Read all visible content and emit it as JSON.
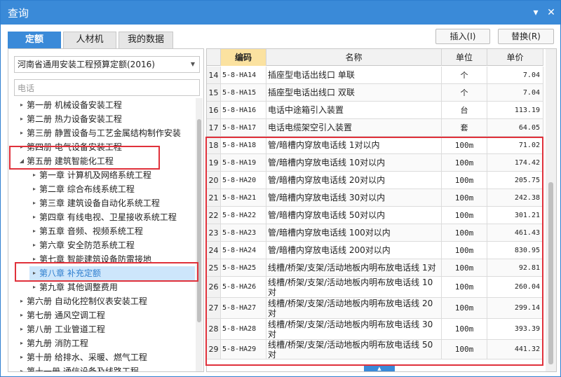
{
  "window": {
    "title": "查询",
    "menu_icon": "▾",
    "close_icon": "✕"
  },
  "tabs": [
    {
      "label": "定额"
    },
    {
      "label": "人材机"
    },
    {
      "label": "我的数据"
    }
  ],
  "actions": {
    "insert": "插入(I)",
    "replace": "替换(R)"
  },
  "library": {
    "selected": "河南省通用安装工程预算定额(2016)"
  },
  "search": {
    "value": "电话"
  },
  "tree": [
    {
      "label": "第一册  机械设备安装工程",
      "toggle": "▸"
    },
    {
      "label": "第二册  热力设备安装工程",
      "toggle": "▸"
    },
    {
      "label": "第三册  静置设备与工艺金属结构制作安装",
      "toggle": "▸"
    },
    {
      "label": "第四册  电气设备安装工程",
      "toggle": "▸"
    },
    {
      "label": "第五册  建筑智能化工程",
      "toggle": "◢"
    },
    {
      "label": "第一章  计算机及网络系统工程",
      "toggle": "▸"
    },
    {
      "label": "第二章  综合布线系统工程",
      "toggle": "▸"
    },
    {
      "label": "第三章  建筑设备自动化系统工程",
      "toggle": "▸"
    },
    {
      "label": "第四章  有线电视、卫星接收系统工程",
      "toggle": "▸"
    },
    {
      "label": "第五章  音频、视频系统工程",
      "toggle": "▸"
    },
    {
      "label": "第六章  安全防范系统工程",
      "toggle": "▸"
    },
    {
      "label": "第七章  智能建筑设备防雷接地",
      "toggle": "▸"
    },
    {
      "label": "第八章  补充定额",
      "toggle": "▸"
    },
    {
      "label": "第九章  其他调整费用",
      "toggle": "▸"
    },
    {
      "label": "第六册  自动化控制仪表安装工程",
      "toggle": "▸"
    },
    {
      "label": "第七册  通风空调工程",
      "toggle": "▸"
    },
    {
      "label": "第八册  工业管道工程",
      "toggle": "▸"
    },
    {
      "label": "第九册  消防工程",
      "toggle": "▸"
    },
    {
      "label": "第十册  给排水、采暖、燃气工程",
      "toggle": "▸"
    },
    {
      "label": "第十一册  通信设备及线路工程",
      "toggle": "▸"
    }
  ],
  "table": {
    "headers": {
      "no": "",
      "code": "编码",
      "name": "名称",
      "unit": "单位",
      "price": "单价"
    },
    "rows": [
      {
        "no": "14",
        "code": "5-8-HA14",
        "name": "插座型电话出线口 单联",
        "unit": "个",
        "price": "7.04"
      },
      {
        "no": "15",
        "code": "5-8-HA15",
        "name": "插座型电话出线口 双联",
        "unit": "个",
        "price": "7.04"
      },
      {
        "no": "16",
        "code": "5-8-HA16",
        "name": "电话中途箱引入装置",
        "unit": "台",
        "price": "113.19"
      },
      {
        "no": "17",
        "code": "5-8-HA17",
        "name": "电话电缆架空引入装置",
        "unit": "套",
        "price": "64.05"
      },
      {
        "no": "18",
        "code": "5-8-HA18",
        "name": "管/暗槽内穿放电话线 1对以内",
        "unit": "100m",
        "price": "71.02"
      },
      {
        "no": "19",
        "code": "5-8-HA19",
        "name": "管/暗槽内穿放电话线 10对以内",
        "unit": "100m",
        "price": "174.42"
      },
      {
        "no": "20",
        "code": "5-8-HA20",
        "name": "管/暗槽内穿放电话线 20对以内",
        "unit": "100m",
        "price": "205.75"
      },
      {
        "no": "21",
        "code": "5-8-HA21",
        "name": "管/暗槽内穿放电话线 30对以内",
        "unit": "100m",
        "price": "242.38"
      },
      {
        "no": "22",
        "code": "5-8-HA22",
        "name": "管/暗槽内穿放电话线 50对以内",
        "unit": "100m",
        "price": "301.21"
      },
      {
        "no": "23",
        "code": "5-8-HA23",
        "name": "管/暗槽内穿放电话线 100对以内",
        "unit": "100m",
        "price": "461.43"
      },
      {
        "no": "24",
        "code": "5-8-HA24",
        "name": "管/暗槽内穿放电话线 200对以内",
        "unit": "100m",
        "price": "830.95"
      },
      {
        "no": "25",
        "code": "5-8-HA25",
        "name": "线槽/桥架/支架/活动地板内明布放电话线 1对",
        "unit": "100m",
        "price": "92.81"
      },
      {
        "no": "26",
        "code": "5-8-HA26",
        "name": "线槽/桥架/支架/活动地板内明布放电话线 10对",
        "unit": "100m",
        "price": "260.04"
      },
      {
        "no": "27",
        "code": "5-8-HA27",
        "name": "线槽/桥架/支架/活动地板内明布放电话线 20对",
        "unit": "100m",
        "price": "299.14"
      },
      {
        "no": "28",
        "code": "5-8-HA28",
        "name": "线槽/桥架/支架/活动地板内明布放电话线 30对",
        "unit": "100m",
        "price": "393.39"
      },
      {
        "no": "29",
        "code": "5-8-HA29",
        "name": "线槽/桥架/支架/活动地板内明布放电话线 50对",
        "unit": "100m",
        "price": "441.32"
      }
    ]
  },
  "splitter_icon": "▲",
  "colors": {
    "titlebar": "#3a8ad8",
    "highlight_box": "#e0313b",
    "selected_row": "#cde6fb",
    "code_header": "#fbe2a0"
  }
}
